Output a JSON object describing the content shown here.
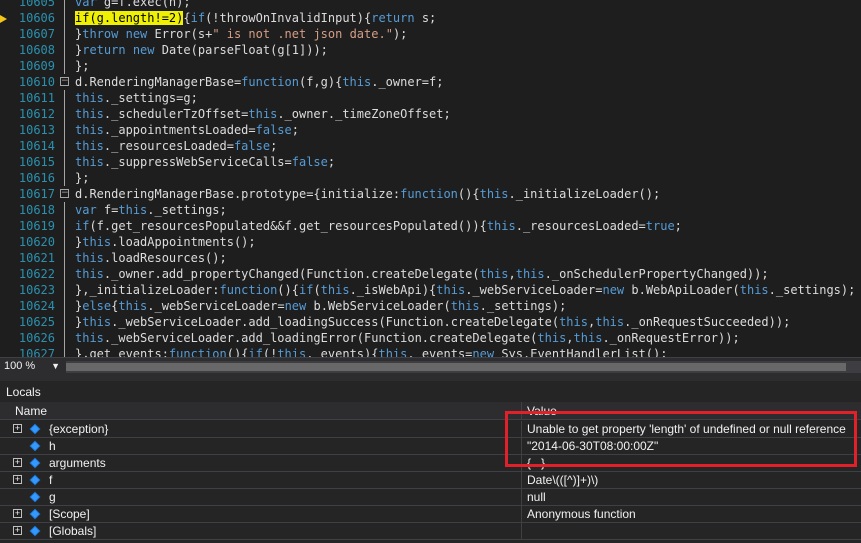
{
  "editor": {
    "lines": [
      {
        "num": "10605",
        "text": "var g=f.exec(h);"
      },
      {
        "num": "10606",
        "text": "if(g.length!=2){if(!throwOnInvalidInput){return s;"
      },
      {
        "num": "10607",
        "text": "}throw new Error(s+\" is not .net json date.\");"
      },
      {
        "num": "10608",
        "text": "}return new Date(parseFloat(g[1]));"
      },
      {
        "num": "10609",
        "text": "};"
      },
      {
        "num": "10610",
        "text": "d.RenderingManagerBase=function(f,g){this._owner=f;"
      },
      {
        "num": "10611",
        "text": "this._settings=g;"
      },
      {
        "num": "10612",
        "text": "this._schedulerTzOffset=this._owner._timeZoneOffset;"
      },
      {
        "num": "10613",
        "text": "this._appointmentsLoaded=false;"
      },
      {
        "num": "10614",
        "text": "this._resourcesLoaded=false;"
      },
      {
        "num": "10615",
        "text": "this._suppressWebServiceCalls=false;"
      },
      {
        "num": "10616",
        "text": "};"
      },
      {
        "num": "10617",
        "text": "d.RenderingManagerBase.prototype={initialize:function(){this._initializeLoader();"
      },
      {
        "num": "10618",
        "text": "var f=this._settings;"
      },
      {
        "num": "10619",
        "text": "if(f.get_resourcesPopulated&&f.get_resourcesPopulated()){this._resourcesLoaded=true;"
      },
      {
        "num": "10620",
        "text": "}this.loadAppointments();"
      },
      {
        "num": "10621",
        "text": "this.loadResources();"
      },
      {
        "num": "10622",
        "text": "this._owner.add_propertyChanged(Function.createDelegate(this,this._onSchedulerPropertyChanged));"
      },
      {
        "num": "10623",
        "text": "},_initializeLoader:function(){if(this._isWebApi){this._webServiceLoader=new b.WebApiLoader(this._settings);"
      },
      {
        "num": "10624",
        "text": "}else{this._webServiceLoader=new b.WebServiceLoader(this._settings);"
      },
      {
        "num": "10625",
        "text": "}this._webServiceLoader.add_loadingSuccess(Function.createDelegate(this,this._onRequestSucceeded));"
      },
      {
        "num": "10626",
        "text": "this._webServiceLoader.add_loadingError(Function.createDelegate(this,this._onRequestError));"
      },
      {
        "num": "10627",
        "text": "},get_events:function(){if(!this._events){this._events=new Sys.EventHandlerList();"
      }
    ],
    "highlight_text": "if(g.length!=2)",
    "highlight_color": "#eff004",
    "current_line_marker_color": "#f5c518"
  },
  "zoom": {
    "value": "100 %"
  },
  "locals": {
    "title": "Locals",
    "columns": {
      "name": "Name",
      "value": "Value"
    },
    "rows": [
      {
        "name": "{exception}",
        "value": "Unable to get property 'length' of undefined or null reference",
        "expandable": true
      },
      {
        "name": "h",
        "value": "\"2014-06-30T08:00:00Z\"",
        "expandable": false
      },
      {
        "name": "arguments",
        "value": "{...}",
        "expandable": true
      },
      {
        "name": "f",
        "value": "Date\\(([^)]+)\\)",
        "expandable": true
      },
      {
        "name": "g",
        "value": "null",
        "expandable": false
      },
      {
        "name": "[Scope]",
        "value": "Anonymous function",
        "expandable": true
      },
      {
        "name": "[Globals]",
        "value": "",
        "expandable": true
      }
    ]
  },
  "annotation_color": "#e2202a"
}
